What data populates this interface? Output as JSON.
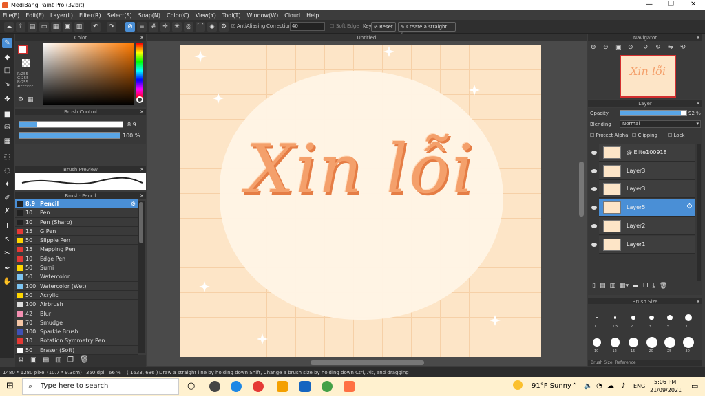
{
  "window": {
    "title": "MediBang Paint Pro (32bit)",
    "min": "—",
    "max": "❐",
    "close": "✕"
  },
  "menu": [
    "File(F)",
    "Edit(E)",
    "Layer(L)",
    "Filter(R)",
    "Select(S)",
    "Snap(N)",
    "Color(C)",
    "View(Y)",
    "Tool(T)",
    "Window(W)",
    "Cloud",
    "Help"
  ],
  "toolbar": {
    "antialias": "AntiAliasing",
    "correction_label": "Correction",
    "correction_value": "40",
    "soft_edge": "Soft Edge",
    "key": "Key",
    "reset": "Reset",
    "straight_line": "Create a straight line"
  },
  "panels": {
    "color": "Color",
    "color_info": "R:255\nG:255\nB:255\n#FFFFFF",
    "brush_control": "Brush Control",
    "brush_size_val": "8.9",
    "opacity_val": "100 %",
    "brush_preview": "Brush Preview",
    "brush_list_title": "Brush: Pencil",
    "canvas_title": "Untitled",
    "navigator": "Navigator",
    "layer": "Layer",
    "brush_size": "Brush Size"
  },
  "brushes": [
    {
      "size": "8.9",
      "name": "Pencil",
      "color": "#222222"
    },
    {
      "size": "10",
      "name": "Pen",
      "color": "#222222"
    },
    {
      "size": "10",
      "name": "Pen (Sharp)",
      "color": "#222222"
    },
    {
      "size": "15",
      "name": "G Pen",
      "color": "#e53935"
    },
    {
      "size": "50",
      "name": "Slipple Pen",
      "color": "#ffd600"
    },
    {
      "size": "15",
      "name": "Mapping Pen",
      "color": "#e53935"
    },
    {
      "size": "10",
      "name": "Edge Pen",
      "color": "#e53935"
    },
    {
      "size": "50",
      "name": "Sumi",
      "color": "#ffd600"
    },
    {
      "size": "50",
      "name": "Watercolor",
      "color": "#7cc3f0"
    },
    {
      "size": "100",
      "name": "Watercolor (Wet)",
      "color": "#7cc3f0"
    },
    {
      "size": "50",
      "name": "Acrylic",
      "color": "#ffd600"
    },
    {
      "size": "100",
      "name": "Airbrush",
      "color": "#dddddd"
    },
    {
      "size": "42",
      "name": "Blur",
      "color": "#f48fb1"
    },
    {
      "size": "70",
      "name": "Smudge",
      "color": "#f5c6a5"
    },
    {
      "size": "100",
      "name": "Sparkle Brush",
      "color": "#3f51b5"
    },
    {
      "size": "10",
      "name": "Rotation Symmetry Pen",
      "color": "#e53935"
    },
    {
      "size": "50",
      "name": "Eraser (Soft)",
      "color": "#ffffff"
    }
  ],
  "layers": {
    "opacity_label": "Opacity",
    "opacity_value": "92 %",
    "opacity_fraction": 0.92,
    "blending_label": "Blending",
    "blending_value": "Normal",
    "protect_alpha": "Protect Alpha",
    "clipping": "Clipping",
    "lock": "Lock",
    "items": [
      {
        "name": "@ Elite100918",
        "selected": false
      },
      {
        "name": "Layer3",
        "selected": false
      },
      {
        "name": "Layer3",
        "selected": false
      },
      {
        "name": "Layer5",
        "selected": true
      },
      {
        "name": "Layer2",
        "selected": false
      },
      {
        "name": "Layer1",
        "selected": false
      }
    ]
  },
  "brush_size_labels": [
    "1",
    "1.5",
    "2",
    "3",
    "5",
    "7",
    "10",
    "12",
    "15",
    "20",
    "25",
    "30"
  ],
  "brush_size_tabs": [
    "Brush Size",
    "Reference"
  ],
  "canvas_text": "Xin lỗi",
  "status": {
    "dims": "1480 * 1280 pixel",
    "cm": "(10.7 * 9.3cm)",
    "dpi": "350 dpi",
    "zoom": "66 %",
    "coord": "( 1633, 686 )",
    "hint": "Draw a straight line by holding down Shift, Change a brush size by holding down Ctrl, Alt, and dragging"
  },
  "taskbar": {
    "search_placeholder": "Type here to search",
    "weather": "91°F  Sunny",
    "lang": "ENG",
    "time": "5:06 PM",
    "date": "21/09/2021"
  }
}
